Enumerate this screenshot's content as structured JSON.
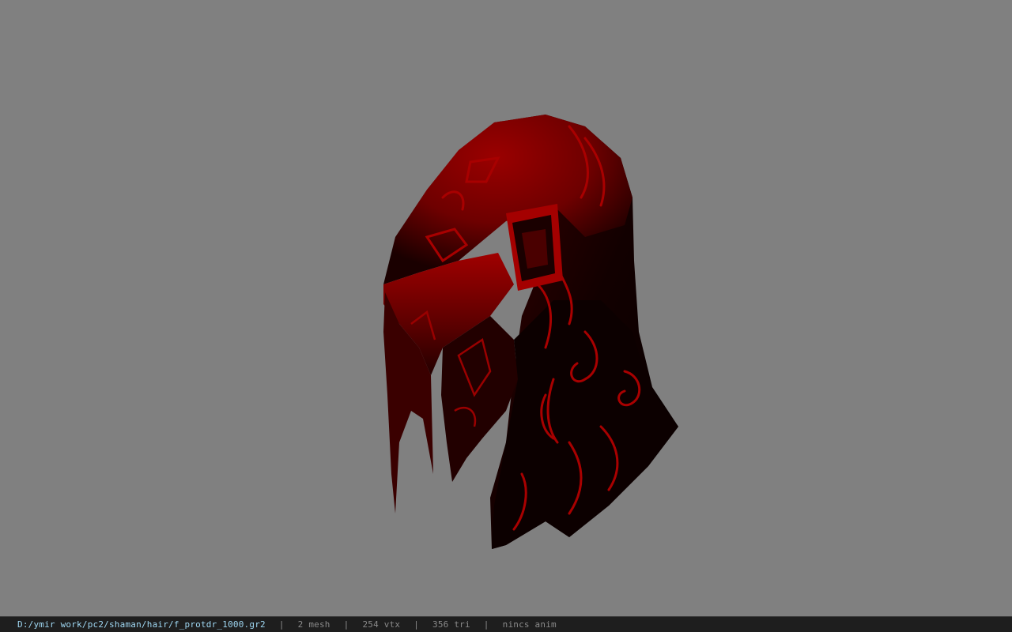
{
  "viewer": {
    "background_color": "#808080",
    "model_icon": "hooded-helmet-model",
    "model_colors": {
      "primary": "#8a0000",
      "highlight": "#b00000",
      "shadow": "#0d0000"
    }
  },
  "status_bar": {
    "file_path": "D:/ymir work/pc2/shaman/hair/f_protdr_1000.gr2",
    "separator": "|",
    "mesh_count": "2 mesh",
    "vertex_count": "254 vtx",
    "triangle_count": "356 tri",
    "animation": "nincs anim"
  }
}
